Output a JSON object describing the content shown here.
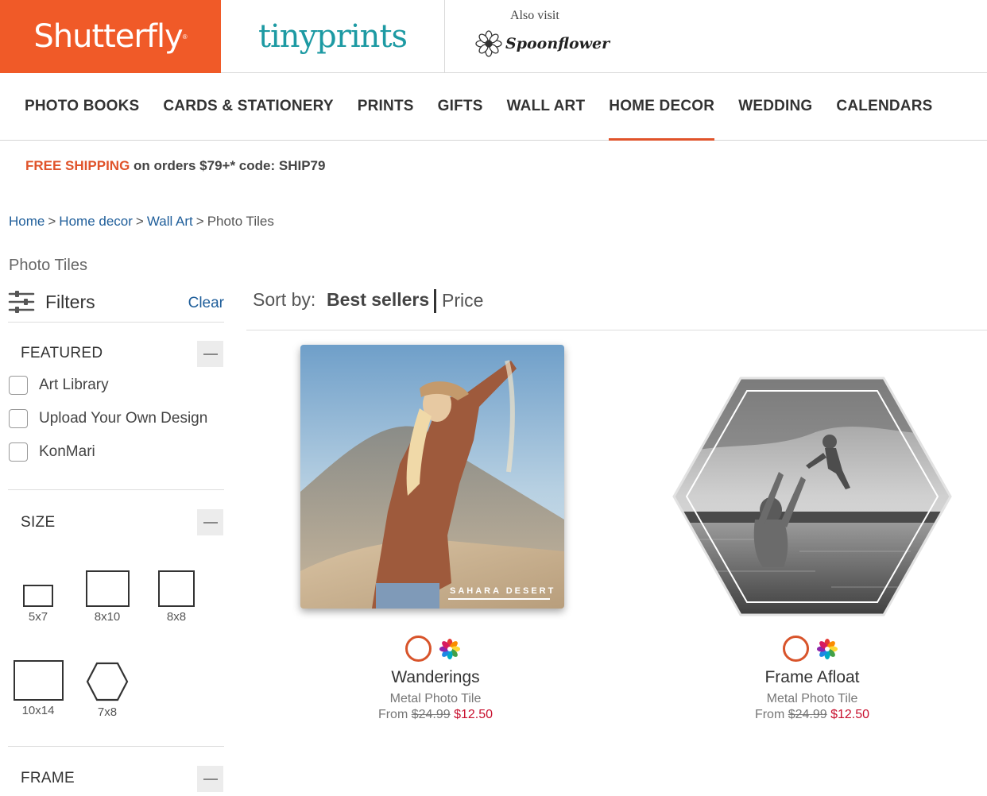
{
  "brands": {
    "shutterfly": "Shutterfly",
    "tinyprints": "tinyprints",
    "also_visit": "Also visit",
    "spoonflower": "Spoonflower"
  },
  "nav": {
    "items": [
      {
        "label": "PHOTO BOOKS"
      },
      {
        "label": "CARDS & STATIONERY"
      },
      {
        "label": "PRINTS"
      },
      {
        "label": "GIFTS"
      },
      {
        "label": "WALL ART"
      },
      {
        "label": "HOME DECOR",
        "active": true
      },
      {
        "label": "WEDDING"
      },
      {
        "label": "CALENDARS"
      }
    ]
  },
  "promo": {
    "highlight": "FREE SHIPPING",
    "text": " on orders $79+* code: SHIP79"
  },
  "breadcrumb": {
    "items": [
      "Home",
      "Home decor",
      "Wall Art"
    ],
    "separator": ">",
    "current": "Photo Tiles"
  },
  "page": {
    "heading": "Photo Tiles"
  },
  "filters": {
    "label": "Filters",
    "clear": "Clear",
    "featured": {
      "title": "FEATURED",
      "options": [
        "Art Library",
        "Upload Your Own Design",
        "KonMari"
      ]
    },
    "size": {
      "title": "SIZE",
      "options": [
        "5x7",
        "8x10",
        "8x8",
        "10x14",
        "7x8"
      ]
    },
    "frame": {
      "title": "FRAME"
    }
  },
  "sort": {
    "label": "Sort by:",
    "active": "Best sellers",
    "other": "Price"
  },
  "products": [
    {
      "title": "Wanderings",
      "subtitle": "Metal Photo Tile",
      "from": "From ",
      "price_old": "$24.99",
      "price_new": "$12.50",
      "image_caption": "SAHARA DESERT"
    },
    {
      "title": "Frame Afloat",
      "subtitle": "Metal Photo Tile",
      "from": "From ",
      "price_old": "$24.99",
      "price_new": "$12.50"
    }
  ],
  "colors": {
    "brand_orange": "#f05a28",
    "tinyprints_teal": "#1d9aa3",
    "link_blue": "#1f5e9a",
    "sale_red": "#c8102e",
    "active_underline": "#e0532a"
  }
}
